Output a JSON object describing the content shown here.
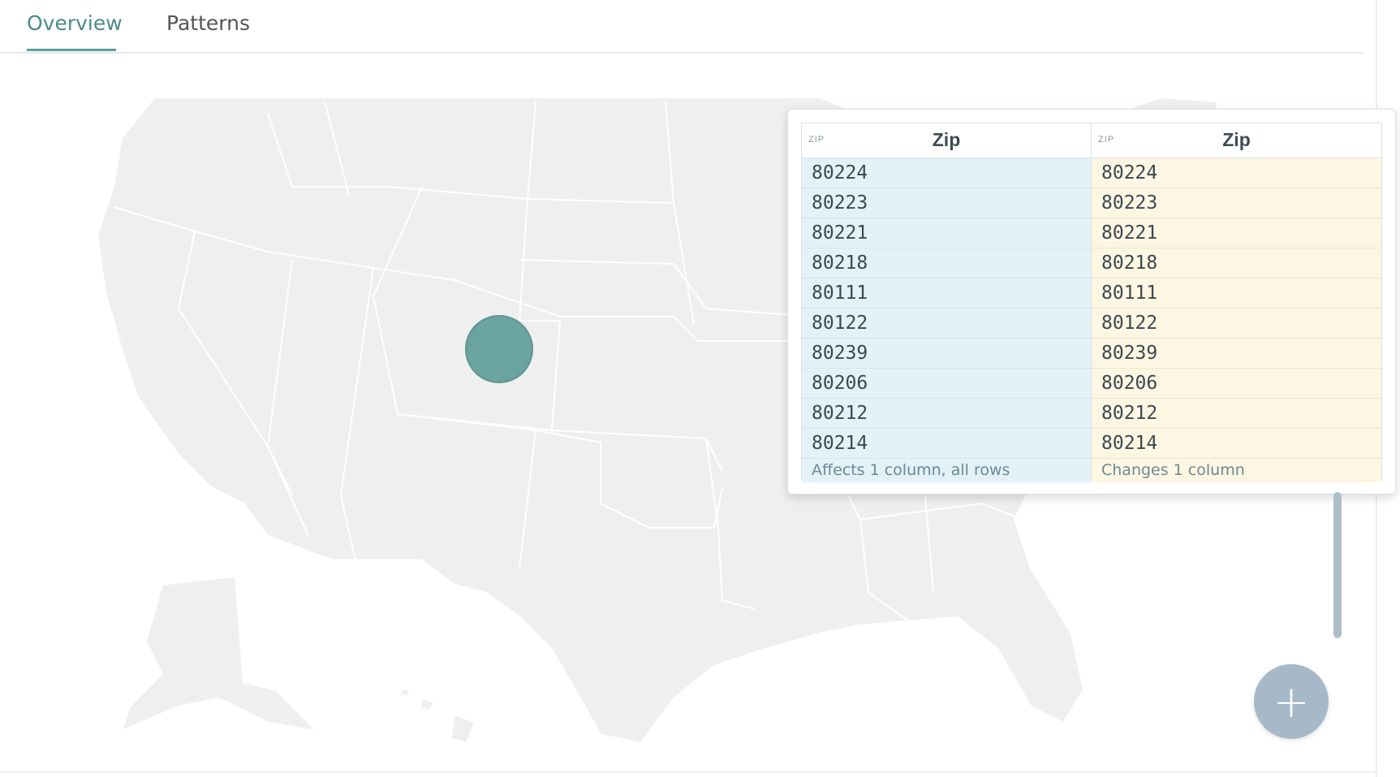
{
  "tabs": {
    "overview_label": "Overview",
    "patterns_label": "Patterns",
    "active": "Overview"
  },
  "map": {
    "region": "United States",
    "marker_color": "#6ba3a0",
    "land_color": "#efefef"
  },
  "comparison": {
    "left": {
      "type_tag": "ZIP",
      "title": "Zip",
      "rows": [
        "80224",
        "80223",
        "80221",
        "80218",
        "80111",
        "80122",
        "80239",
        "80206",
        "80212",
        "80214"
      ],
      "footer": "Affects 1 column, all rows",
      "highlight_color": "#e3f1f8"
    },
    "right": {
      "type_tag": "ZIP",
      "title": "Zip",
      "rows": [
        "80224",
        "80223",
        "80221",
        "80218",
        "80111",
        "80122",
        "80239",
        "80206",
        "80212",
        "80214"
      ],
      "footer": "Changes 1 column",
      "highlight_color": "#fdf6e2"
    }
  },
  "fab": {
    "icon": "plus-icon",
    "symbol": "+"
  },
  "colors": {
    "accent": "#5aa09c"
  }
}
